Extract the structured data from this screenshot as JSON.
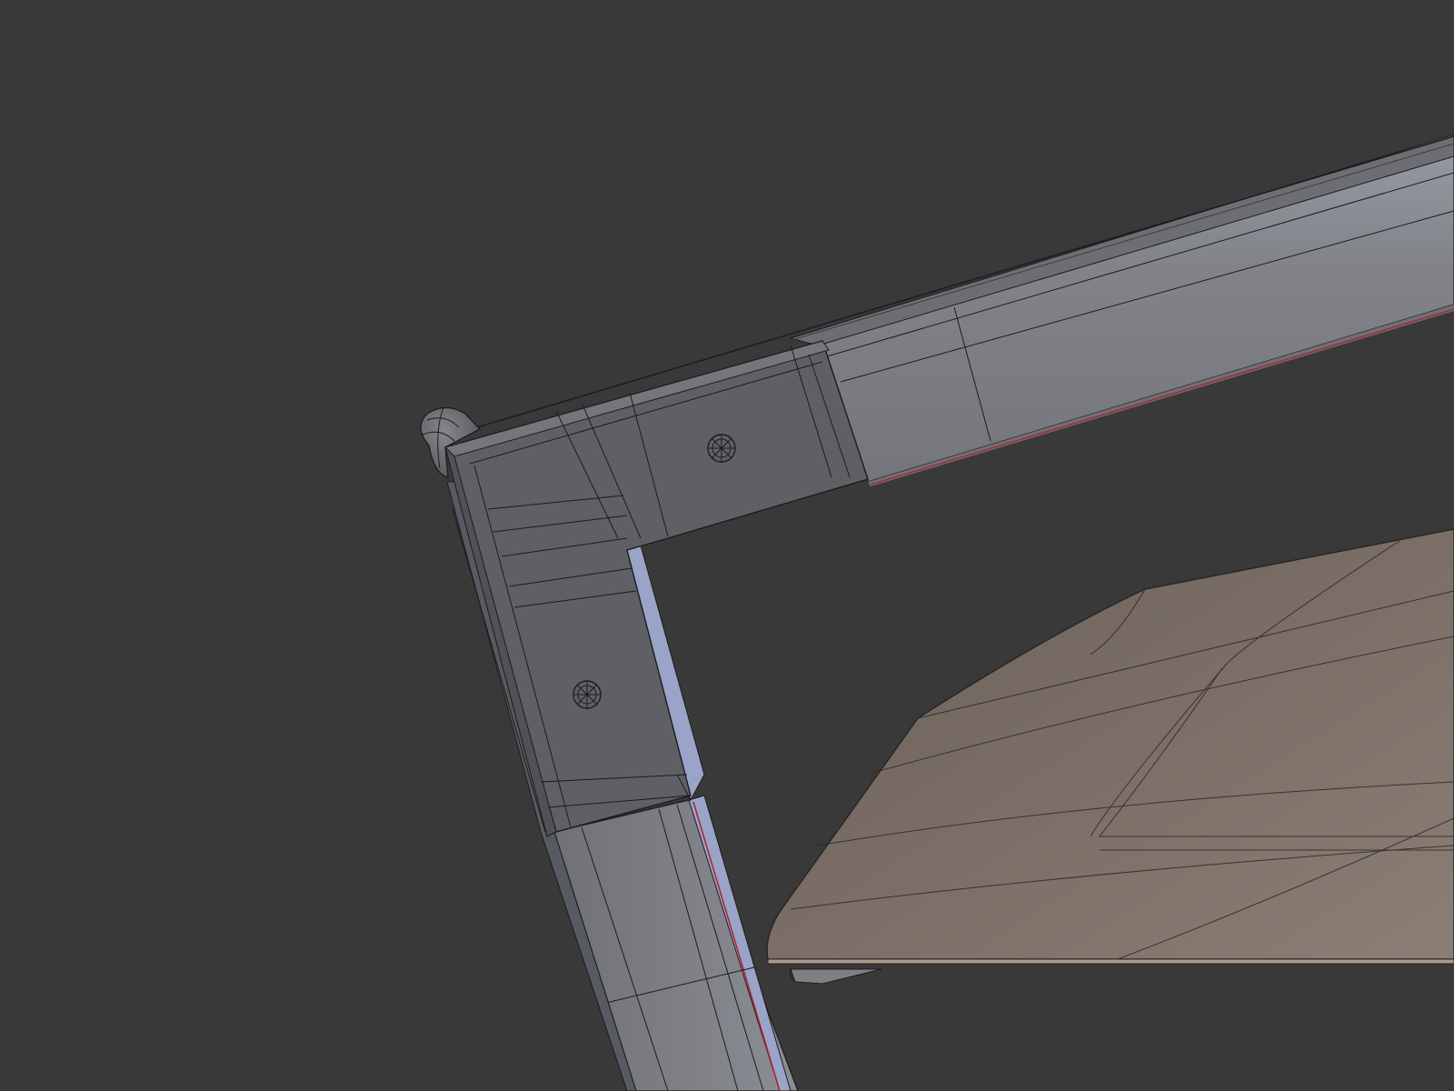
{
  "viewport": {
    "background_color": "#393939",
    "shading": "solid",
    "overlay": "wireframe"
  },
  "scene": {
    "objects": [
      {
        "name": "frame-top-rail",
        "color": "#7e8086"
      },
      {
        "name": "frame-corner-bracket",
        "color": "#5e5f63"
      },
      {
        "name": "frame-side-rail",
        "color": "#7e8086"
      },
      {
        "name": "corner-end-cap",
        "color": "#686a6f"
      },
      {
        "name": "fabric-panel",
        "color": "#7a6e66"
      }
    ],
    "edge_color": "#1c1c1c",
    "seam_color": "#b0202a",
    "rim_highlight": "#9aa3c8"
  }
}
